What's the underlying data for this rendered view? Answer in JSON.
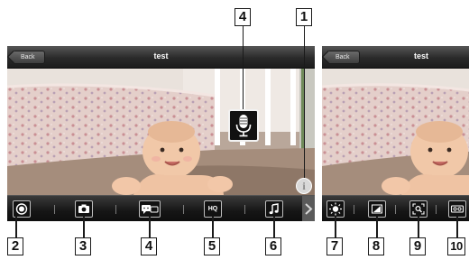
{
  "left_screen": {
    "back_label": "Back",
    "title": "test"
  },
  "right_screen": {
    "back_label": "Back",
    "title": "test"
  },
  "toolbar_left": {
    "hq_label": "HQ"
  },
  "callouts": {
    "c1": "1",
    "c2": "2",
    "c3": "3",
    "c4_bottom": "4",
    "c4_top": "4",
    "c5": "5",
    "c6": "6",
    "c7": "7",
    "c8": "8",
    "c9": "9",
    "c10": "10"
  },
  "icons": {
    "record": "record-icon",
    "snapshot": "camera-icon",
    "talk": "talk-icon",
    "quality": "hq-icon",
    "music": "music-note-icon",
    "next": "chevron-right-icon",
    "microphone": "microphone-icon",
    "info": "info-icon",
    "brightness": "brightness-icon",
    "signal": "signal-icon",
    "zoom": "zoom-icon",
    "playback": "playback-icon"
  },
  "colors": {
    "toolbar_dark": "#161616",
    "titlebar_dark": "#2a2a2a",
    "callout_border": "#1a1a1a"
  }
}
